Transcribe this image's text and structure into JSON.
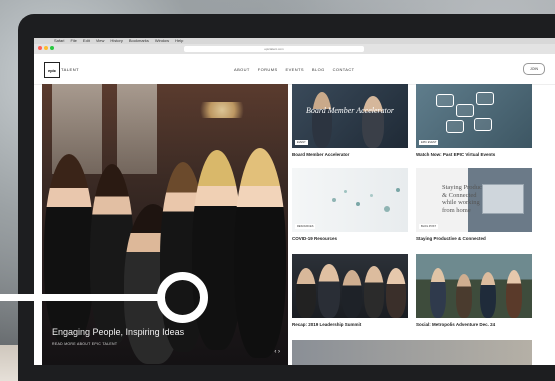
{
  "browser": {
    "menu": [
      "Safari",
      "File",
      "Edit",
      "View",
      "History",
      "Bookmarks",
      "Window",
      "Help"
    ],
    "url": "epictalent.com"
  },
  "header": {
    "logo_text": "epic",
    "brand": "TALENT",
    "nav": [
      "ABOUT",
      "FORUMS",
      "EVENTS",
      "BLOG",
      "CONTACT"
    ],
    "join_label": "JOIN"
  },
  "hero": {
    "caption": "Engaging People, Inspiring Ideas",
    "link": "READ MORE ABOUT EPIC TALENT"
  },
  "cards": [
    {
      "title": "Board Member Accelerator",
      "overlay": "Board Member Accelerator",
      "tag": "EVENT"
    },
    {
      "title": "Watch Now: Past EPIC Virtual Events",
      "overlay": "",
      "tag": "EPIC EVENT"
    },
    {
      "title": "COVID-19 Resources",
      "overlay": "",
      "tag": "RESOURCES"
    },
    {
      "title": "Staying Productive & Connected",
      "overlay": "Staying Productive & Connected while working from home",
      "tag": "BLOG POST"
    },
    {
      "title": "Recap: 2019 Leadership Summit",
      "overlay": "",
      "tag": "EVENT"
    },
    {
      "title": "Social: Metropolis Adventure Dec. 24",
      "overlay": "",
      "tag": "SOCIAL"
    }
  ]
}
